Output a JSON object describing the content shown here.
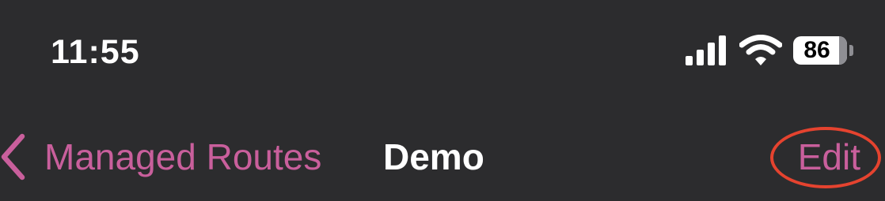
{
  "status_bar": {
    "time": "11:55",
    "battery_level": "86",
    "icons": [
      "signal-icon",
      "wifi-icon",
      "battery-icon"
    ]
  },
  "nav_bar": {
    "back_label": "Managed Routes",
    "title": "Demo",
    "edit_label": "Edit",
    "back_icon": "chevron-left-icon"
  },
  "colors": {
    "background": "#2c2c2e",
    "accent": "#c95f9c",
    "highlight": "#e5432f",
    "text": "#ffffff"
  }
}
